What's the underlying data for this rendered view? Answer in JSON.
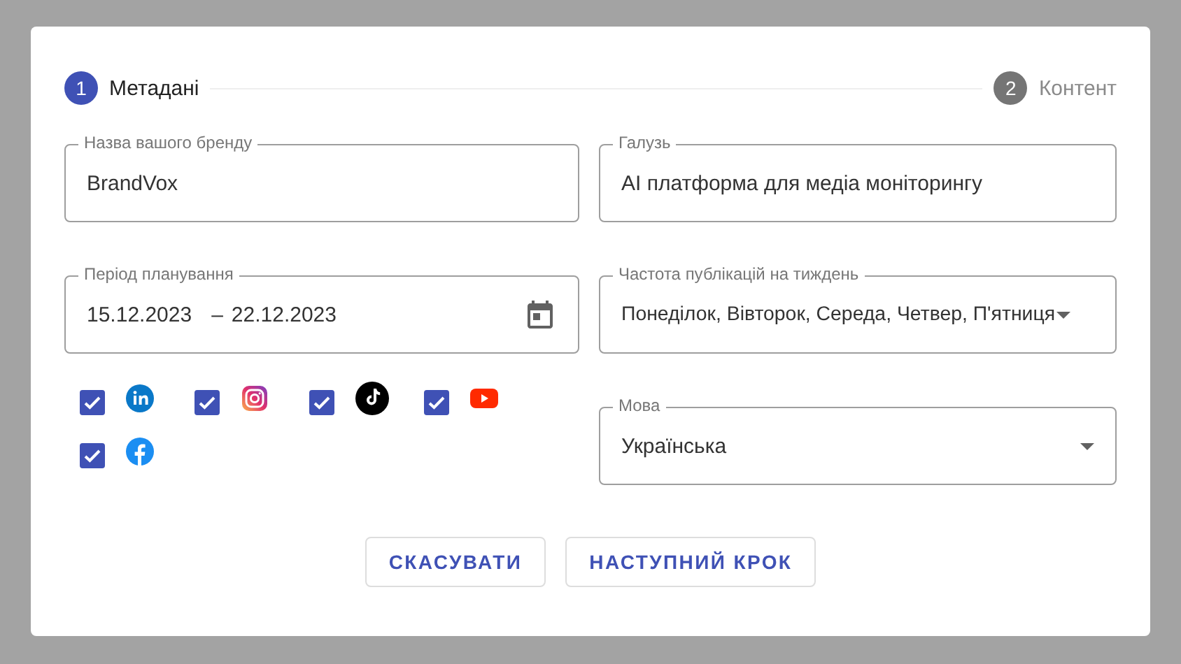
{
  "stepper": [
    {
      "number": "1",
      "label": "Метадані",
      "selected": true
    },
    {
      "number": "2",
      "label": "Контент",
      "selected": false
    }
  ],
  "brand_field": {
    "label": "Назва вашого бренду",
    "value": "BrandVox"
  },
  "industry_field": {
    "label": "Галузь",
    "value": "AI платформа для медіа моніторингу"
  },
  "period_field": {
    "label": "Період планування",
    "start": "15.12.2023",
    "separator": "–",
    "end": "22.12.2023"
  },
  "frequency_field": {
    "label": "Частота публікацій на тиждень",
    "value": "Понеділок, Вівторок, Середа, Четвер, П'ятниця"
  },
  "language_field": {
    "label": "Мова",
    "value": "Українська"
  },
  "networks": [
    {
      "kind": "linkedin",
      "checked": true
    },
    {
      "kind": "instagram",
      "checked": true
    },
    {
      "kind": "tiktok",
      "checked": true
    },
    {
      "kind": "youtube",
      "checked": true
    },
    {
      "kind": "facebook",
      "checked": true
    }
  ],
  "buttons": [
    "СКАСУВАТИ",
    "НАСТУПНИЙ КРОК"
  ]
}
